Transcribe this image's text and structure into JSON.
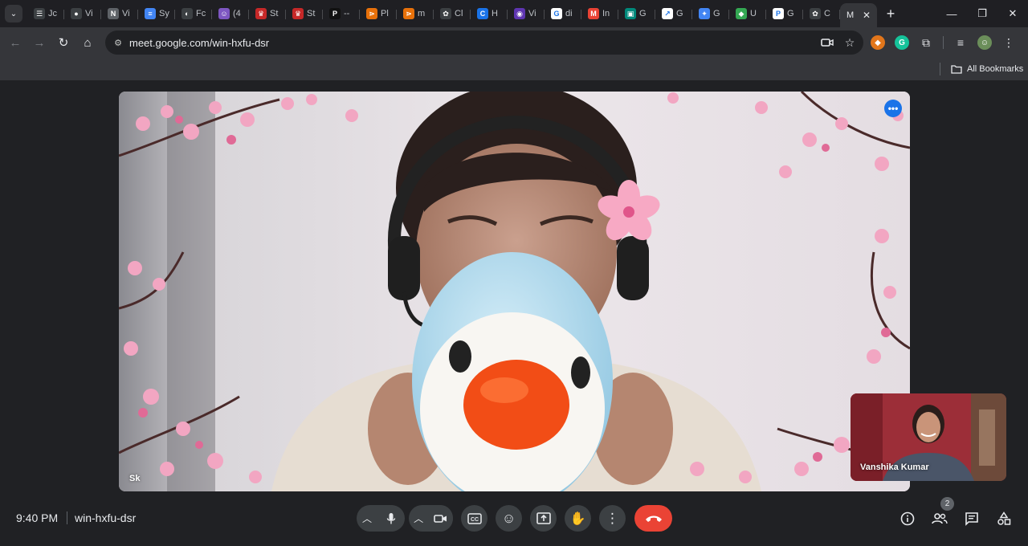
{
  "browser": {
    "tabs": [
      {
        "icon": "text-icon",
        "label": "Jc",
        "color": "#3c4043",
        "glyph": "☰"
      },
      {
        "icon": "github-icon",
        "label": "Vi",
        "color": "#3c4043",
        "glyph": "●"
      },
      {
        "icon": "n-icon",
        "label": "Vi",
        "color": "#5f6368",
        "glyph": "N"
      },
      {
        "icon": "docs-icon",
        "label": "Sy",
        "color": "#4285f4",
        "glyph": "≡"
      },
      {
        "icon": "moon-icon",
        "label": "Fc",
        "color": "#3c4043",
        "glyph": "◐"
      },
      {
        "icon": "avatar-icon",
        "label": "(4",
        "color": "#7e57c2",
        "glyph": "☺"
      },
      {
        "icon": "crown-icon",
        "label": "St",
        "color": "#c62828",
        "glyph": "♛"
      },
      {
        "icon": "crown-icon",
        "label": "St",
        "color": "#c62828",
        "glyph": "♛"
      },
      {
        "icon": "p-icon",
        "label": "--",
        "color": "#111111",
        "glyph": "P"
      },
      {
        "icon": "orange-share-icon",
        "label": "Pl",
        "color": "#e8710a",
        "glyph": "⋗"
      },
      {
        "icon": "orange-share-icon",
        "label": "m",
        "color": "#e8710a",
        "glyph": "⋗"
      },
      {
        "icon": "openai-icon",
        "label": "Cl",
        "color": "#3c4043",
        "glyph": "✿"
      },
      {
        "icon": "c-icon",
        "label": "H",
        "color": "#1a73e8",
        "glyph": "C"
      },
      {
        "icon": "globe-icon",
        "label": "Vi",
        "color": "#5e35b1",
        "glyph": "◉"
      },
      {
        "icon": "google-icon",
        "label": "di",
        "color": "#ffffff",
        "glyph": "G"
      },
      {
        "icon": "gmail-icon",
        "label": "In",
        "color": "#ea4335",
        "glyph": "M"
      },
      {
        "icon": "meet-icon",
        "label": "G",
        "color": "#00897b",
        "glyph": "▣"
      },
      {
        "icon": "chart-icon",
        "label": "G",
        "color": "#ffffff",
        "glyph": "↗"
      },
      {
        "icon": "gemini-icon",
        "label": "G",
        "color": "#4285f4",
        "glyph": "✦"
      },
      {
        "icon": "android-icon",
        "label": "U",
        "color": "#34a853",
        "glyph": "◆"
      },
      {
        "icon": "p-circle-icon",
        "label": "G",
        "color": "#ffffff",
        "glyph": "P"
      },
      {
        "icon": "openai-icon",
        "label": "C",
        "color": "#3c4043",
        "glyph": "✿"
      }
    ],
    "active_tab": {
      "label": "M",
      "close": "✕"
    },
    "new_tab": "+",
    "window_controls": {
      "minimize": "—",
      "maximize": "❐",
      "close": "✕"
    },
    "url": "meet.google.com/win-hxfu-dsr",
    "bookmarks_label": "All Bookmarks"
  },
  "meet": {
    "main_participant": "Sk",
    "self_participant": "Vanshika Kumar",
    "clock": "9:40 PM",
    "meeting_code": "win-hxfu-dsr",
    "people_count": "2"
  },
  "colors": {
    "accent": "#1a73e8",
    "hangup": "#ea4335",
    "control_bg": "#3c4043",
    "page_bg": "#202124"
  }
}
